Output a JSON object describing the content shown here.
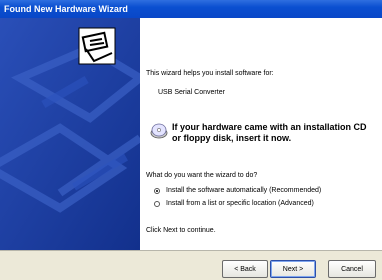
{
  "window": {
    "title": "Found New Hardware Wizard"
  },
  "main": {
    "intro": "This wizard helps you install software for:",
    "device_name": "USB Serial Converter",
    "cd_notice_line1": "If your hardware came with an installation CD",
    "cd_notice_line2": "or floppy disk, insert it now.",
    "question": "What do you want the wizard to do?",
    "options": [
      {
        "label": "Install the software automatically (Recommended)",
        "selected": true
      },
      {
        "label": "Install from a list or specific location (Advanced)",
        "selected": false
      }
    ],
    "continue_hint": "Click Next to continue."
  },
  "buttons": {
    "back": "< Back",
    "next": "Next >",
    "cancel": "Cancel"
  },
  "icons": {
    "hardware": "hardware-wizard-icon",
    "cd": "cd-icon"
  },
  "colors": {
    "titlebar": "#0a4fd0",
    "left_panel": "#1c3a9e",
    "bottom_bar": "#ece9d8"
  }
}
